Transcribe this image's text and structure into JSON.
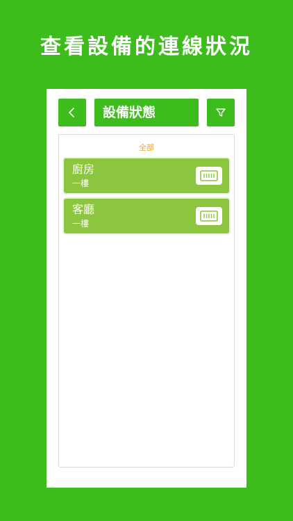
{
  "headline": "查看設備的連線狀況",
  "header": {
    "title": "設備狀態",
    "back_icon": "chevron-left-icon",
    "filter_icon": "filter-icon"
  },
  "list": {
    "group_label": "全部",
    "devices": [
      {
        "name": "廚房",
        "floor": "一樓",
        "icon": "device-module-icon"
      },
      {
        "name": "客廳",
        "floor": "一樓",
        "icon": "device-module-icon"
      }
    ]
  },
  "colors": {
    "brand_green": "#3dbd1c",
    "card_green": "#8cc63f",
    "group_label": "#f0a830"
  }
}
